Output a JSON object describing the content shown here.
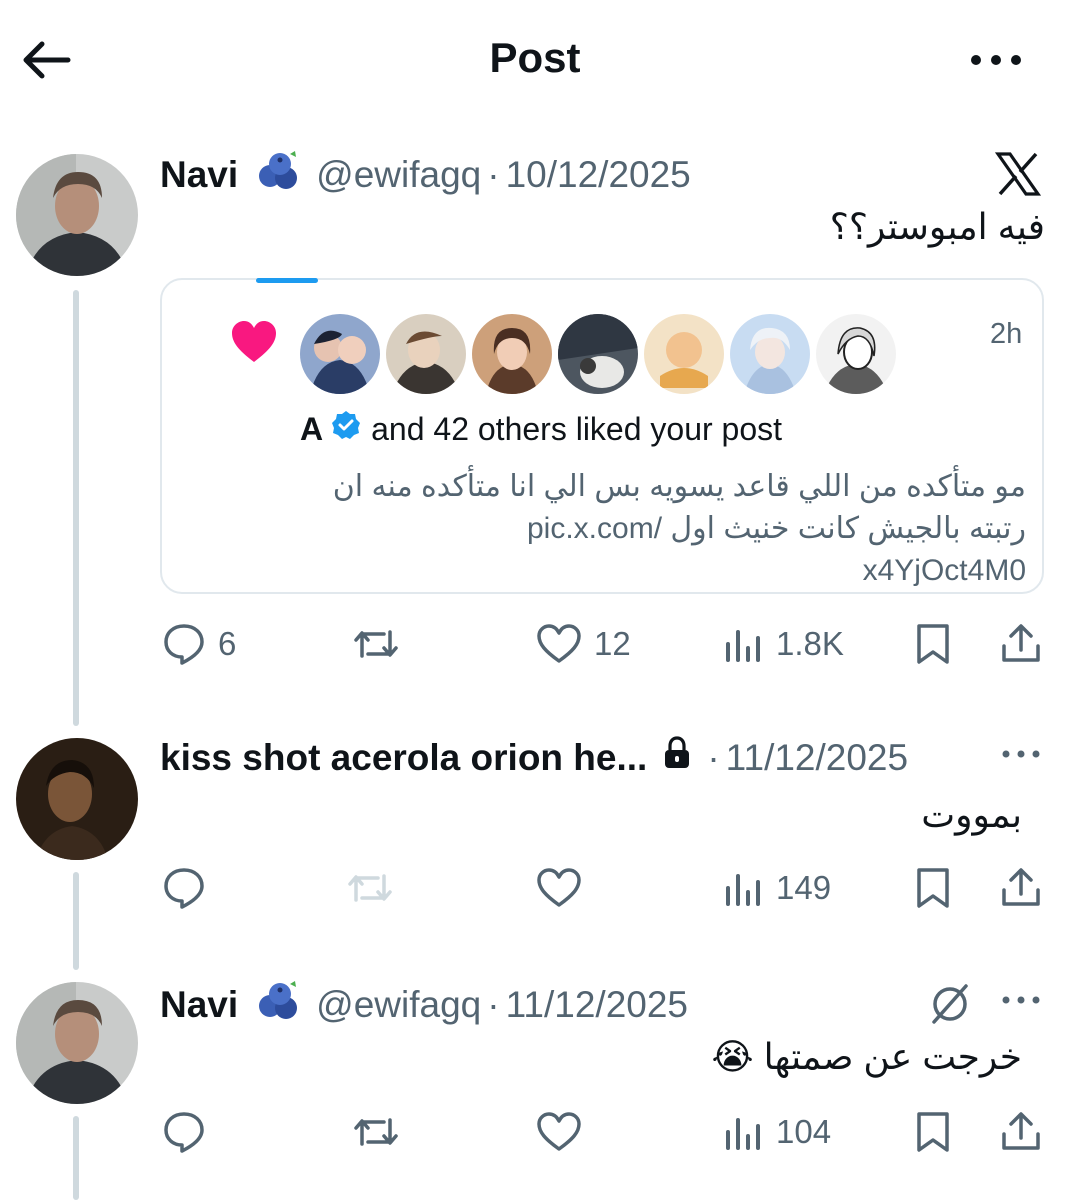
{
  "header": {
    "title": "Post",
    "back_icon": "arrow-left-icon",
    "more_icon": "ellipsis-icon"
  },
  "post": {
    "name": "Navi",
    "handle": "@ewifagq",
    "date": "10/12/2025",
    "text": "فيه امبوستر؟؟",
    "source_icon": "x-logo-icon",
    "quote": {
      "time": "2h",
      "liked_by": "A",
      "liked_text": "and 42 others liked your post",
      "body_line1": "مو متأكده من اللي قاعد يسويه بس الي انا متأكده منه ان",
      "body_line2": "رتبته بالجيش كانت خنيث اول /pic.x.com",
      "body_line3": "x4YjOct4M0"
    },
    "stats": {
      "replies": "6",
      "reposts": "",
      "likes": "12",
      "views": "1.8K"
    }
  },
  "replies": [
    {
      "name": "kiss shot acerola orion he...",
      "date": "11/12/2025",
      "text": "بمووت",
      "stats": {
        "replies": "",
        "reposts": "",
        "likes": "",
        "views": "149"
      }
    },
    {
      "name": "Navi",
      "handle": "@ewifagq",
      "date": "11/12/2025",
      "text": "خرجت عن صمتها 😭",
      "stats": {
        "replies": "",
        "reposts": "",
        "likes": "",
        "views": "104"
      }
    }
  ],
  "colors": {
    "accent": "#1d9bf0",
    "like_pink": "#f91880",
    "muted": "#536471",
    "text": "#0f1419",
    "thread_line": "#cfd9de"
  }
}
